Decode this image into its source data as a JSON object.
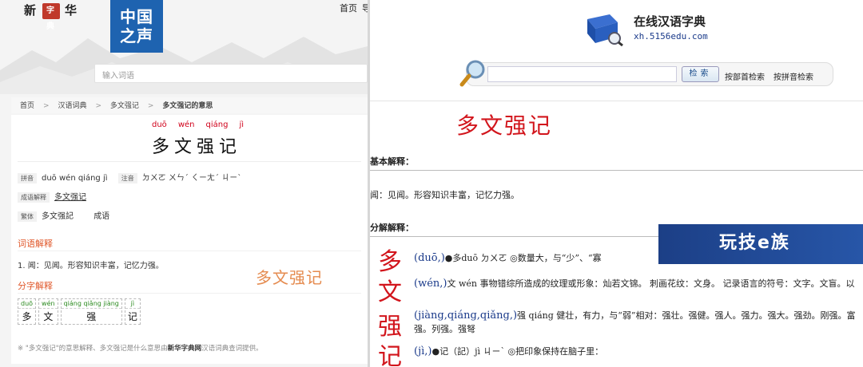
{
  "left": {
    "logo": {
      "c1": "新",
      "seal": "字典",
      "c2": "华"
    },
    "nav": {
      "home": "首页",
      "more": "导"
    },
    "zgzs": {
      "l1": "中国",
      "l2": "之声"
    },
    "search_placeholder": "输入词语",
    "breadcrumb": [
      "首页",
      "汉语词典",
      "多文强记",
      "多文强记的意思"
    ],
    "pinyin": [
      "duō",
      "wén",
      "qiáng",
      "jì"
    ],
    "title": "多文强记",
    "info": {
      "pinyin_tag": "拼音",
      "pinyin_val": "duō wén qiáng jì",
      "zhuyin_tag": "注音",
      "zhuyin_val": "ㄉㄨㄛ ㄨㄣˊ ㄑㄧㄤˊ ㄐㄧˋ",
      "idiom_tag": "成语解释",
      "idiom_val": "多文强记",
      "trad_tag": "繁体",
      "trad_val": "多文强記",
      "trad_extra": "成语"
    },
    "sec_ciyu": "词语解释",
    "definition": "1. 闻：见闻。形容知识丰富，记忆力强。",
    "overlay": "多文强记",
    "sec_zi": "分字解释",
    "chars": [
      {
        "py": "duō",
        "c": "多"
      },
      {
        "py": "wén",
        "c": "文"
      },
      {
        "py": "qiáng qiǎng jiàng",
        "c": "强"
      },
      {
        "py": "jì",
        "c": "记"
      }
    ],
    "footer_pre": "※ \"多文强记\"的意思解释、多文强记是什么意思由",
    "footer_brand": "新华字典网",
    "footer_post": "汉语词典查词提供。"
  },
  "right": {
    "site_title": "在线汉语字典",
    "site_url": "xh.5156edu.com",
    "search_btn": "检索",
    "link_radical": "按部首检索",
    "link_pinyin": "按拼音检索",
    "word": "多文强记",
    "basic_head": "基本解释：",
    "basic_text": "闻：见闻。形容知识丰富，记忆力强。",
    "split_head": "分解解释：",
    "banner": "玩技e族",
    "entries": [
      {
        "big": "多",
        "py": "(duō,)",
        "text": "●多duō ㄉㄨㄛ ◎数量大，与“少”、“寡"
      },
      {
        "big": "文",
        "py": "(wén,)",
        "text": "文 wén 事物错综所造成的纹理或形象：灿若文锦。 刺画花纹：文身。 记录语言的符号：文字。文盲。以"
      },
      {
        "big": "强",
        "py": "(jiàng,qiáng,qiǎng,)",
        "text": "强 qiáng 健壮，有力，与“弱”相对：强壮。强健。强人。强力。强大。强劲。刚强。富强。列强。强弩"
      },
      {
        "big": "记",
        "py": "(jì,)",
        "text": "●记（記）jì ㄐㄧˋ ◎把印象保持在脑子里："
      }
    ]
  }
}
